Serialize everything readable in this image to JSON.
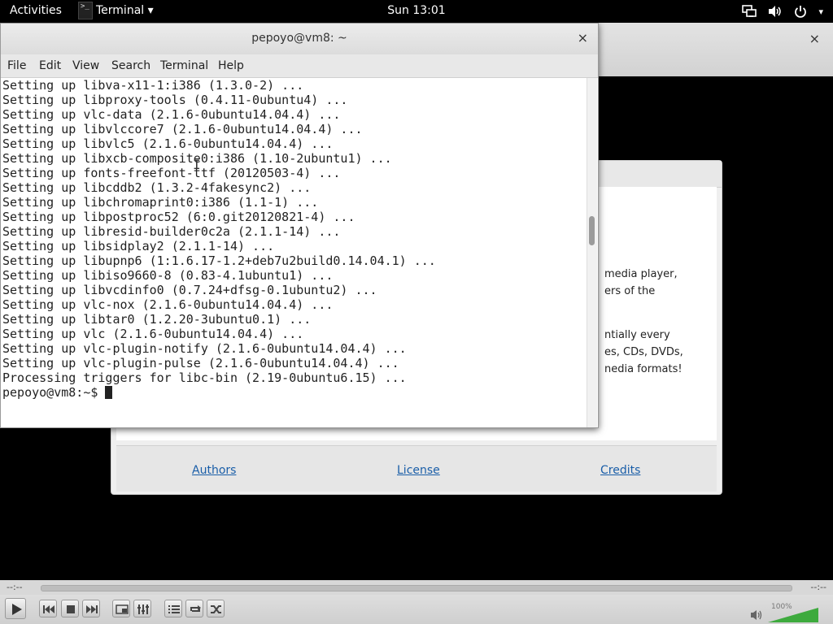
{
  "top_panel": {
    "activities": "Activities",
    "app_menu": "Terminal ▾",
    "app_icon_glyph": ">_",
    "clock": "Sun 13:01",
    "tray_icons": [
      "network-icon",
      "volume-icon",
      "power-icon"
    ],
    "tray_dropdown": "▾"
  },
  "vlc": {
    "close_glyph": "×",
    "time_elapsed": "--:--",
    "time_remaining": "--:--",
    "volume_percent": "100%",
    "volume_level": 1.0,
    "accent": "#3daa3d"
  },
  "about_dialog": {
    "text_lines": [
      "media player,",
      "ers of the",
      "",
      "ntially every",
      "es, CDs, DVDs,",
      "nedia formats!"
    ],
    "links": {
      "authors": "Authors",
      "license": "License",
      "credits": "Credits"
    }
  },
  "terminal": {
    "title": "pepoyo@vm8: ~",
    "close_glyph": "×",
    "menu": {
      "file": "File",
      "edit": "Edit",
      "view": "View",
      "search": "Search",
      "terminal": "Terminal",
      "help": "Help"
    },
    "lines": [
      "Setting up libva-x11-1:i386 (1.3.0-2) ...",
      "Setting up libproxy-tools (0.4.11-0ubuntu4) ...",
      "Setting up vlc-data (2.1.6-0ubuntu14.04.4) ...",
      "Setting up libvlccore7 (2.1.6-0ubuntu14.04.4) ...",
      "Setting up libvlc5 (2.1.6-0ubuntu14.04.4) ...",
      "Setting up libxcb-composite0:i386 (1.10-2ubuntu1) ...",
      "Setting up fonts-freefont-ttf (20120503-4) ...",
      "Setting up libcddb2 (1.3.2-4fakesync2) ...",
      "Setting up libchromaprint0:i386 (1.1-1) ...",
      "Setting up libpostproc52 (6:0.git20120821-4) ...",
      "Setting up libresid-builder0c2a (2.1.1-14) ...",
      "Setting up libsidplay2 (2.1.1-14) ...",
      "Setting up libupnp6 (1:1.6.17-1.2+deb7u2build0.14.04.1) ...",
      "Setting up libiso9660-8 (0.83-4.1ubuntu1) ...",
      "Setting up libvcdinfo0 (0.7.24+dfsg-0.1ubuntu2) ...",
      "Setting up vlc-nox (2.1.6-0ubuntu14.04.4) ...",
      "Setting up libtar0 (1.2.20-3ubuntu0.1) ...",
      "Setting up vlc (2.1.6-0ubuntu14.04.4) ...",
      "Setting up vlc-plugin-notify (2.1.6-0ubuntu14.04.4) ...",
      "Setting up vlc-plugin-pulse (2.1.6-0ubuntu14.04.4) ...",
      "Processing triggers for libc-bin (2.19-0ubuntu6.15) ..."
    ],
    "prompt": "pepoyo@vm8:~$ "
  }
}
